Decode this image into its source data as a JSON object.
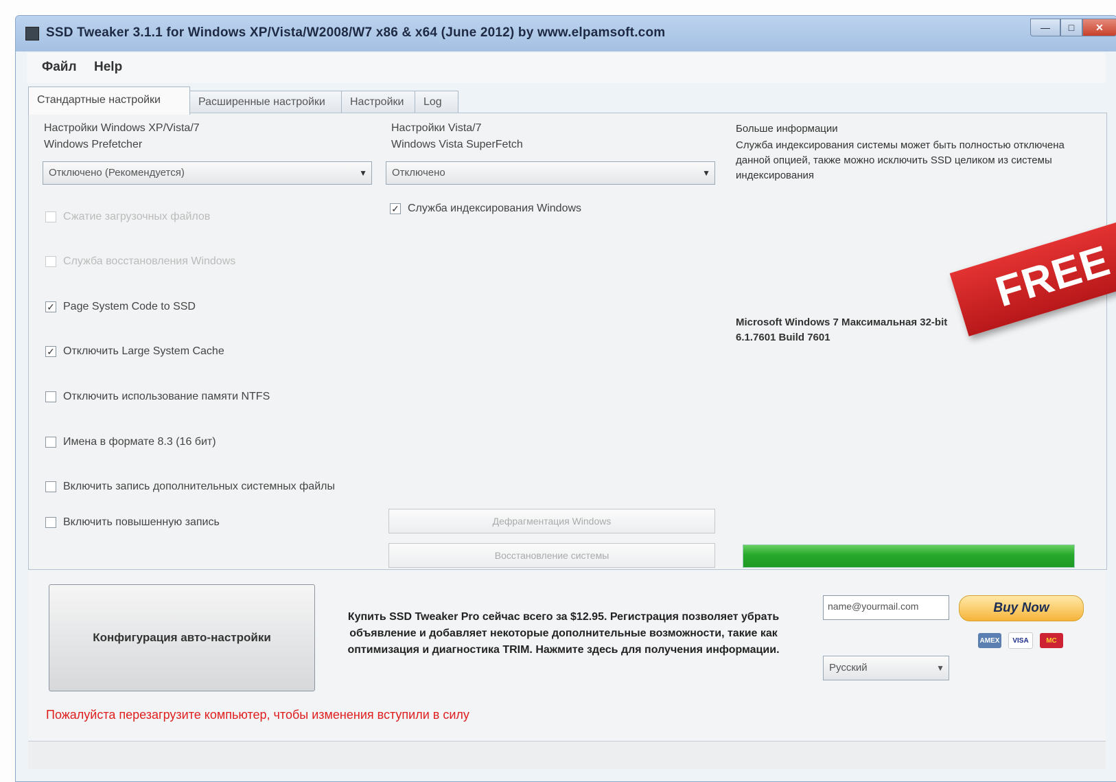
{
  "window": {
    "title": "SSD Tweaker 3.1.1 for Windows XP/Vista/W2008/W7 x86 & x64 (June 2012) by www.elpamsoft.com",
    "min_label": "—",
    "max_label": "□",
    "close_label": "✕"
  },
  "menu": {
    "file": "Файл",
    "help": "Help"
  },
  "tabs": [
    {
      "label": "Стандартные настройки"
    },
    {
      "label": "Расширенные настройки"
    },
    {
      "label": "Настройки"
    },
    {
      "label": "Log"
    }
  ],
  "left": {
    "label": "Настройки Windows XP/Vista/7\nWindows Prefetcher",
    "select_value": "Отключено (Рекомендуется)",
    "checkboxes": [
      {
        "label": "Сжатие загрузочных файлов",
        "checked": false,
        "disabled": true
      },
      {
        "label": "Служба восстановления Windows",
        "checked": false,
        "disabled": true
      },
      {
        "label": "Page System Code to SSD",
        "checked": true,
        "disabled": false
      },
      {
        "label": "Отключить Large System Cache",
        "checked": true,
        "disabled": false
      },
      {
        "label": "Отключить использование памяти NTFS",
        "checked": false,
        "disabled": false
      },
      {
        "label": "Имена в формате 8.3 (16 бит)",
        "checked": false,
        "disabled": false
      },
      {
        "label": "Включить запись дополнительных системных файлы",
        "checked": false,
        "disabled": false
      },
      {
        "label": "Включить повышенную запись",
        "checked": false,
        "disabled": false
      }
    ]
  },
  "middle": {
    "label": "Настройки Vista/7\nWindows Vista SuperFetch",
    "select_value": "Отключено",
    "checkbox": {
      "label": "Служба индексирования Windows",
      "checked": true
    },
    "button1": "Дефрагментация Windows",
    "button2": "Восстановление системы"
  },
  "right": {
    "info_title": "Больше информации",
    "info_text": "Служба индексирования системы может быть полностью отключена данной опцией, также можно исключить SSD целиком из системы индексирования",
    "os_info": "Microsoft Windows 7 Максимальная 32-bit\n6.1.7601 Build 7601",
    "progress": 1.0,
    "progress_color": "#2aa92e"
  },
  "bottom": {
    "auto_config_button": "Конфигурация авто-настройки",
    "promo_text": "Купить SSD Tweaker Pro сейчас всего за $12.95. Регистрация позволяет убрать объявление и добавляет некоторые дополнительные возможности, такие как оптимизация и диагностика TRIM. Нажмите здесь для получения информации.",
    "email_value": "name@yourmail.com",
    "buy_label": "Buy Now",
    "cards": [
      "AMEX",
      "VISA",
      "MC"
    ],
    "language_value": "Русский",
    "warning_text": "Пожалуйста перезагрузите компьютер, чтобы изменения вступили в силу"
  },
  "badge": {
    "text": "FREE",
    "color": "#d22426"
  },
  "colors": {
    "accent": "#2aa92e",
    "warning": "#e01e1e",
    "title_bar": "#b4cbea"
  }
}
